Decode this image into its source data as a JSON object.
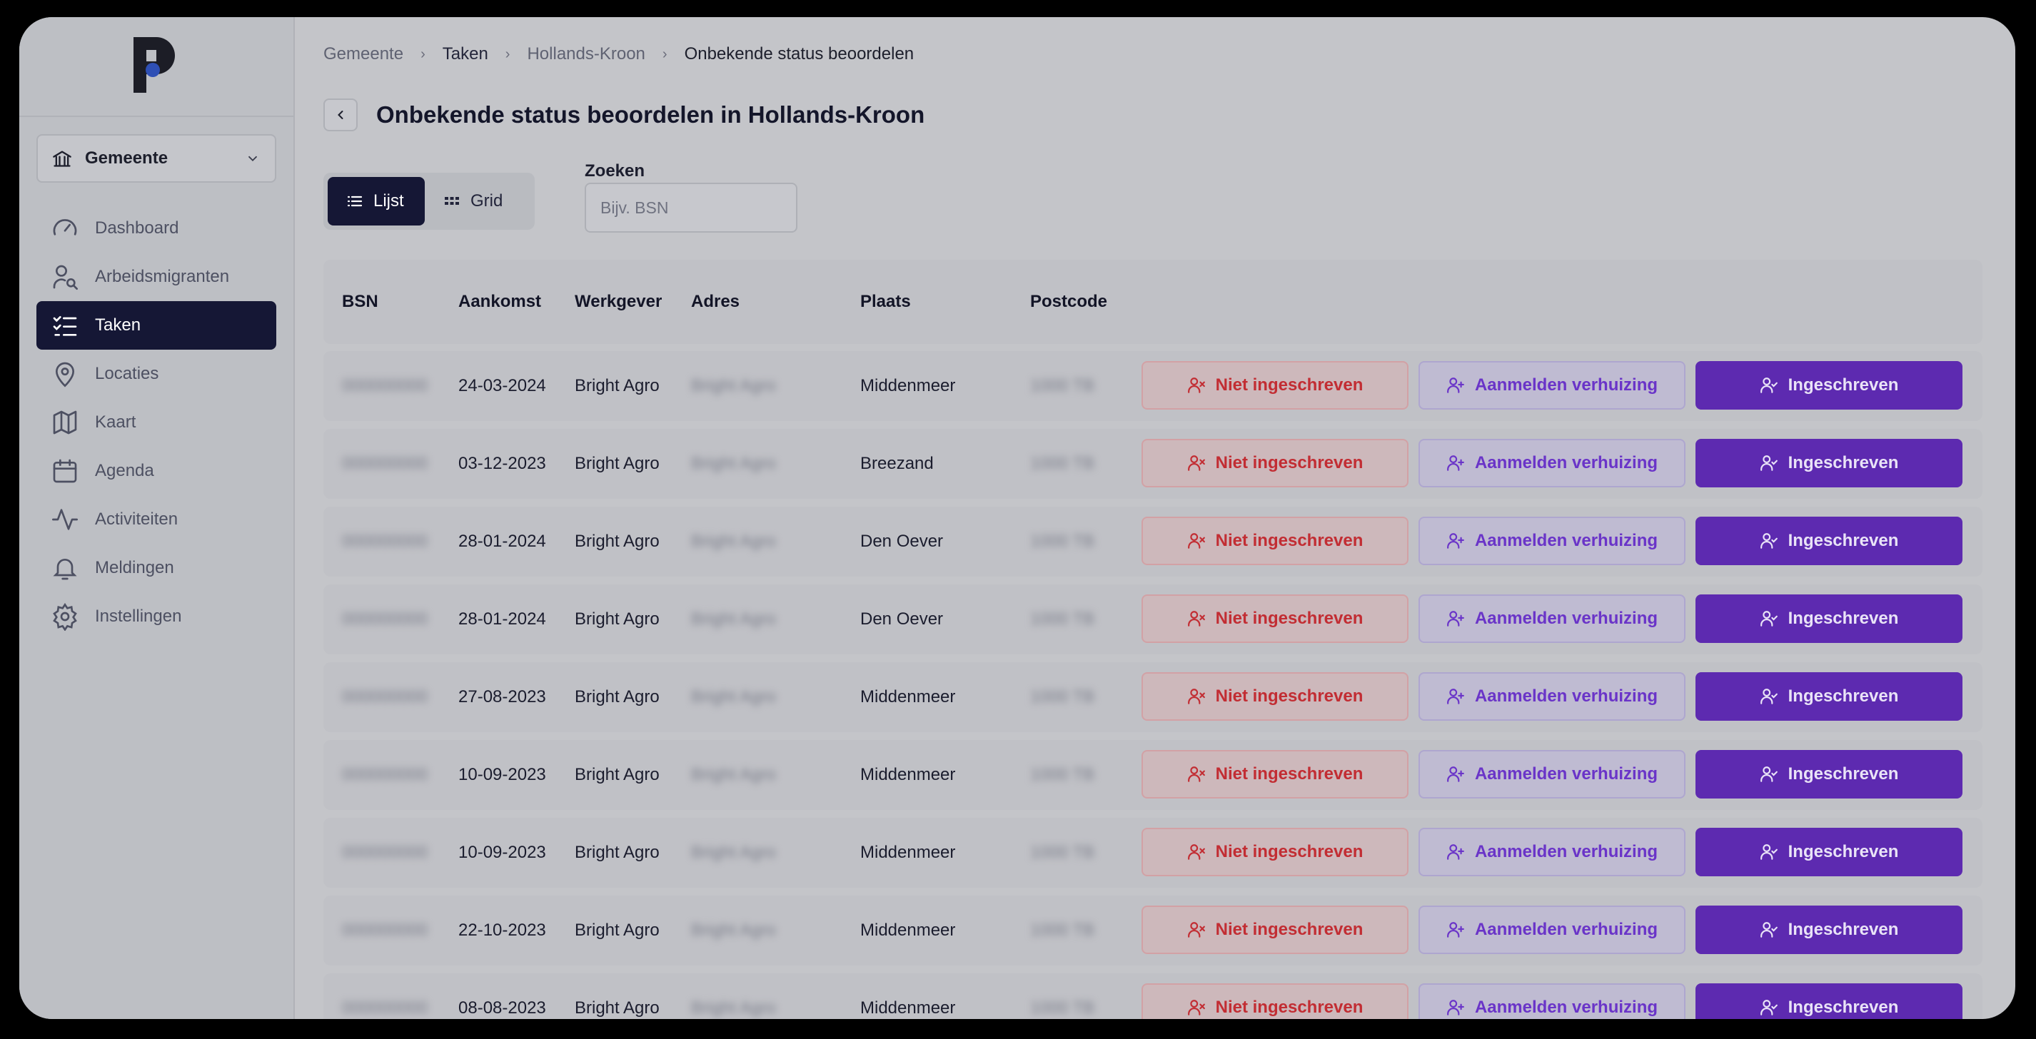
{
  "sidebar": {
    "org_select": {
      "label": "Gemeente"
    },
    "items": [
      {
        "label": "Dashboard",
        "icon": "gauge-icon"
      },
      {
        "label": "Arbeidsmigranten",
        "icon": "user-search-icon"
      },
      {
        "label": "Taken",
        "icon": "list-check-icon",
        "active": true
      },
      {
        "label": "Locaties",
        "icon": "map-pin-icon"
      },
      {
        "label": "Kaart",
        "icon": "map-icon"
      },
      {
        "label": "Agenda",
        "icon": "calendar-icon"
      },
      {
        "label": "Activiteiten",
        "icon": "activity-icon"
      },
      {
        "label": "Meldingen",
        "icon": "bell-icon"
      },
      {
        "label": "Instellingen",
        "icon": "gear-icon"
      }
    ]
  },
  "breadcrumb": [
    "Gemeente",
    "Taken",
    "Hollands-Kroon",
    "Onbekende status beoordelen"
  ],
  "page": {
    "title": "Onbekende status beoordelen in Hollands-Kroon"
  },
  "view_toggle": {
    "list_label": "Lijst",
    "grid_label": "Grid",
    "active": "Lijst"
  },
  "search": {
    "label": "Zoeken",
    "placeholder": "Bijv. BSN",
    "value": ""
  },
  "table": {
    "headers": [
      "BSN",
      "Aankomst",
      "Werkgever",
      "Adres",
      "Plaats",
      "Postcode"
    ],
    "actions": {
      "not_registered": "Niet ingeschreven",
      "report_move": "Aanmelden verhuizing",
      "registered": "Ingeschreven"
    },
    "rows": [
      {
        "bsn": "000000000",
        "aankomst": "24-03-2024",
        "werkgever": "Bright Agro",
        "adres": "Bright Agro",
        "plaats": "Middenmeer",
        "postcode": "1000 TB"
      },
      {
        "bsn": "000000000",
        "aankomst": "03-12-2023",
        "werkgever": "Bright Agro",
        "adres": "Bright Agro",
        "plaats": "Breezand",
        "postcode": "1000 TB"
      },
      {
        "bsn": "000000000",
        "aankomst": "28-01-2024",
        "werkgever": "Bright Agro",
        "adres": "Bright Agro",
        "plaats": "Den Oever",
        "postcode": "1000 TB"
      },
      {
        "bsn": "000000000",
        "aankomst": "28-01-2024",
        "werkgever": "Bright Agro",
        "adres": "Bright Agro",
        "plaats": "Den Oever",
        "postcode": "1000 TB"
      },
      {
        "bsn": "000000000",
        "aankomst": "27-08-2023",
        "werkgever": "Bright Agro",
        "adres": "Bright Agro",
        "plaats": "Middenmeer",
        "postcode": "1000 TB"
      },
      {
        "bsn": "000000000",
        "aankomst": "10-09-2023",
        "werkgever": "Bright Agro",
        "adres": "Bright Agro",
        "plaats": "Middenmeer",
        "postcode": "1000 TB"
      },
      {
        "bsn": "000000000",
        "aankomst": "10-09-2023",
        "werkgever": "Bright Agro",
        "adres": "Bright Agro",
        "plaats": "Middenmeer",
        "postcode": "1000 TB"
      },
      {
        "bsn": "000000000",
        "aankomst": "22-10-2023",
        "werkgever": "Bright Agro",
        "adres": "Bright Agro",
        "plaats": "Middenmeer",
        "postcode": "1000 TB"
      },
      {
        "bsn": "000000000",
        "aankomst": "08-08-2023",
        "werkgever": "Bright Agro",
        "adres": "Bright Agro",
        "plaats": "Middenmeer",
        "postcode": "1000 TB"
      }
    ]
  },
  "colors": {
    "nav_active": "#151735",
    "danger": "#c22d33",
    "accent_purple": "#5d2ab0",
    "accent_lilac_text": "#6a34c8"
  }
}
